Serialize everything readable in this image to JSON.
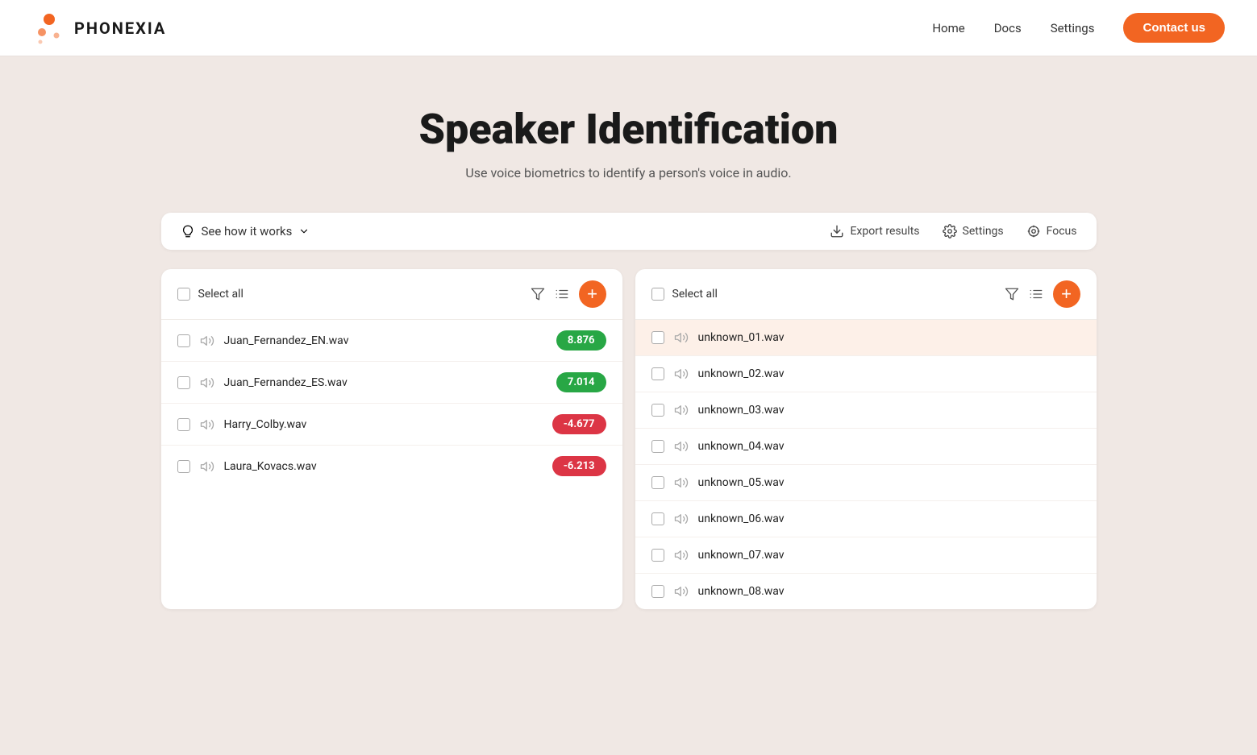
{
  "nav": {
    "logo_text": "PHONEXIA",
    "links": [
      {
        "label": "Home",
        "name": "home"
      },
      {
        "label": "Docs",
        "name": "docs"
      },
      {
        "label": "Settings",
        "name": "settings"
      }
    ],
    "contact_label": "Contact us"
  },
  "hero": {
    "title": "Speaker Identification",
    "subtitle": "Use voice biometrics to identify a person's voice in audio."
  },
  "toolbar": {
    "see_how_label": "See how it works",
    "export_label": "Export results",
    "settings_label": "Settings",
    "focus_label": "Focus"
  },
  "left_panel": {
    "select_all_label": "Select all",
    "items": [
      {
        "name": "Juan_Fernandez_EN.wav",
        "score": "8.876",
        "score_type": "green"
      },
      {
        "name": "Juan_Fernandez_ES.wav",
        "score": "7.014",
        "score_type": "green"
      },
      {
        "name": "Harry_Colby.wav",
        "score": "-4.677",
        "score_type": "red"
      },
      {
        "name": "Laura_Kovacs.wav",
        "score": "-6.213",
        "score_type": "red"
      }
    ]
  },
  "right_panel": {
    "select_all_label": "Select all",
    "items": [
      {
        "name": "unknown_01.wav",
        "highlighted": true
      },
      {
        "name": "unknown_02.wav",
        "highlighted": false
      },
      {
        "name": "unknown_03.wav",
        "highlighted": false
      },
      {
        "name": "unknown_04.wav",
        "highlighted": false
      },
      {
        "name": "unknown_05.wav",
        "highlighted": false
      },
      {
        "name": "unknown_06.wav",
        "highlighted": false
      },
      {
        "name": "unknown_07.wav",
        "highlighted": false
      },
      {
        "name": "unknown_08.wav",
        "highlighted": false
      }
    ]
  }
}
